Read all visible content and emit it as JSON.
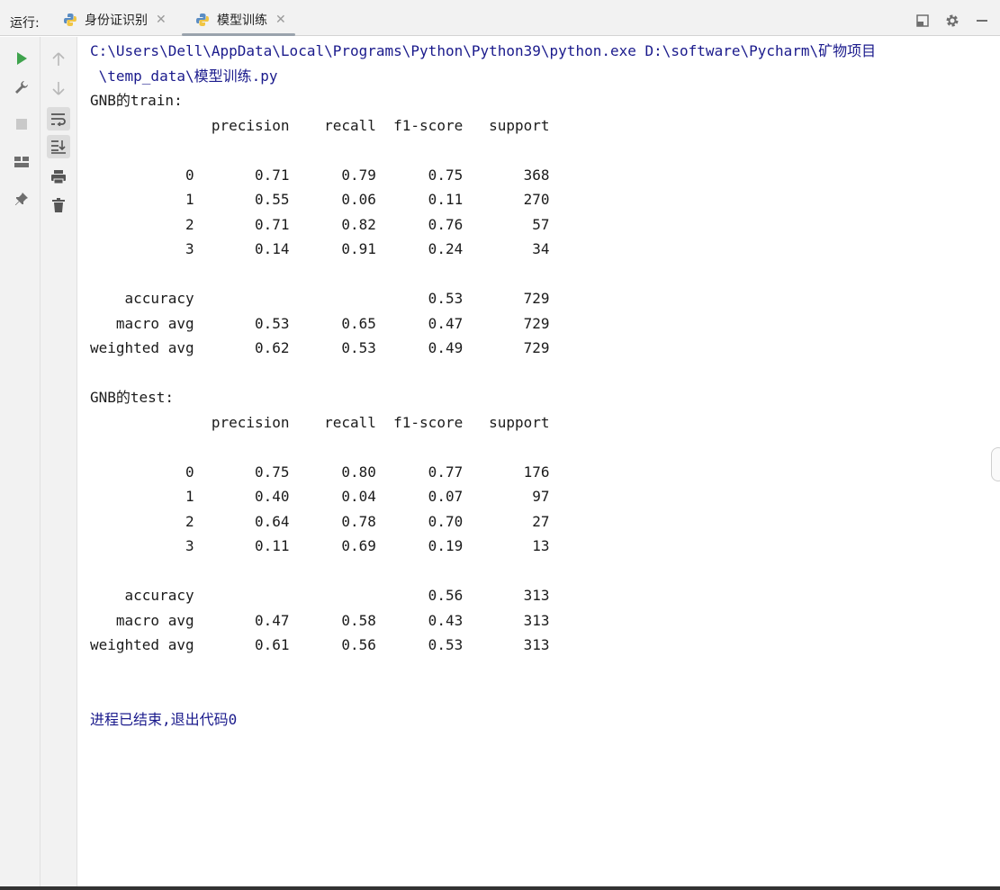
{
  "tabbar": {
    "run_label": "运行:",
    "tabs": [
      {
        "label": "身份证识别",
        "active": false
      },
      {
        "label": "模型训练",
        "active": true
      }
    ]
  },
  "console": {
    "command_line_1": "C:\\Users\\Dell\\AppData\\Local\\Programs\\Python\\Python39\\python.exe D:\\software\\Pycharm\\矿物项目",
    "command_line_2": " \\temp_data\\模型训练.py",
    "train_header": "GNB的train:",
    "train_report": "              precision    recall  f1-score   support\n\n           0       0.71      0.79      0.75       368\n           1       0.55      0.06      0.11       270\n           2       0.71      0.82      0.76        57\n           3       0.14      0.91      0.24        34\n\n    accuracy                           0.53       729\n   macro avg       0.53      0.65      0.47       729\nweighted avg       0.62      0.53      0.49       729",
    "test_header": "GNB的test:",
    "test_report": "              precision    recall  f1-score   support\n\n           0       0.75      0.80      0.77       176\n           1       0.40      0.04      0.07        97\n           2       0.64      0.78      0.70        27\n           3       0.11      0.69      0.19        13\n\n    accuracy                           0.56       313\n   macro avg       0.47      0.58      0.43       313\nweighted avg       0.61      0.56      0.53       313",
    "exit_message": "进程已结束,退出代码0"
  },
  "icons": {
    "run": "run-icon",
    "wrench": "wrench-icon",
    "stop": "stop-icon",
    "layout": "layout-icon",
    "pin": "pin-icon",
    "up": "arrow-up-icon",
    "down": "arrow-down-icon",
    "soft_wrap": "soft-wrap-icon",
    "scroll_end": "scroll-to-end-icon",
    "print": "print-icon",
    "trash": "trash-icon"
  },
  "colors": {
    "command_text": "#1a1a8c",
    "run_green": "#3fa34d",
    "toolbar_bg": "#f2f2f2"
  }
}
